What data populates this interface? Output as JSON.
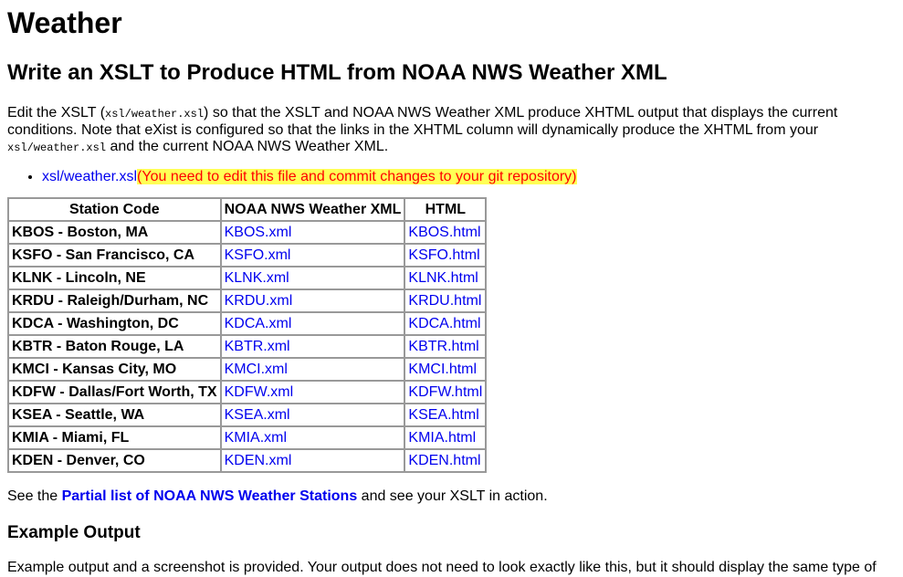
{
  "title": "Weather",
  "subtitle": "Write an XSLT to Produce HTML from NOAA NWS Weather XML",
  "intro": {
    "part1": "Edit the XSLT (",
    "code1": "xsl/weather.xsl",
    "part2": ") so that the XSLT and NOAA NWS Weather XML produce XHTML output that displays the current conditions. Note that eXist is configured so that the links in the XHTML column will dynamically produce the XHTML from your ",
    "code2": "xsl/weather.xsl",
    "part3": " and the current NOAA NWS Weather XML."
  },
  "file_link": {
    "label": "xsl/weather.xsl",
    "note": "(You need to edit this file and commit changes to your git repository)"
  },
  "table": {
    "headers": [
      "Station Code",
      "NOAA NWS Weather XML",
      "HTML"
    ],
    "rows": [
      {
        "station": "KBOS - Boston, MA",
        "xml": "KBOS.xml",
        "html": "KBOS.html"
      },
      {
        "station": "KSFO - San Francisco, CA",
        "xml": "KSFO.xml",
        "html": "KSFO.html"
      },
      {
        "station": "KLNK - Lincoln, NE",
        "xml": "KLNK.xml",
        "html": "KLNK.html"
      },
      {
        "station": "KRDU - Raleigh/Durham, NC",
        "xml": "KRDU.xml",
        "html": "KRDU.html"
      },
      {
        "station": "KDCA - Washington, DC",
        "xml": "KDCA.xml",
        "html": "KDCA.html"
      },
      {
        "station": "KBTR - Baton Rouge, LA",
        "xml": "KBTR.xml",
        "html": "KBTR.html"
      },
      {
        "station": "KMCI - Kansas City, MO",
        "xml": "KMCI.xml",
        "html": "KMCI.html"
      },
      {
        "station": "KDFW - Dallas/Fort Worth, TX",
        "xml": "KDFW.xml",
        "html": "KDFW.html"
      },
      {
        "station": "KSEA - Seattle, WA",
        "xml": "KSEA.xml",
        "html": "KSEA.html"
      },
      {
        "station": "KMIA - Miami, FL",
        "xml": "KMIA.xml",
        "html": "KMIA.html"
      },
      {
        "station": "KDEN - Denver, CO",
        "xml": "KDEN.xml",
        "html": "KDEN.html"
      }
    ]
  },
  "see": {
    "prefix": "See the ",
    "link": "Partial list of NOAA NWS Weather Stations",
    "suffix": " and see your XSLT in action."
  },
  "example_heading": "Example Output",
  "example_text": "Example output and a screenshot is provided. Your output does not need to look exactly like this, but it should display the same type of",
  "colors": {
    "link": "#0000ee",
    "highlight_bg": "#ffff55",
    "highlight_text": "#ff0000"
  }
}
